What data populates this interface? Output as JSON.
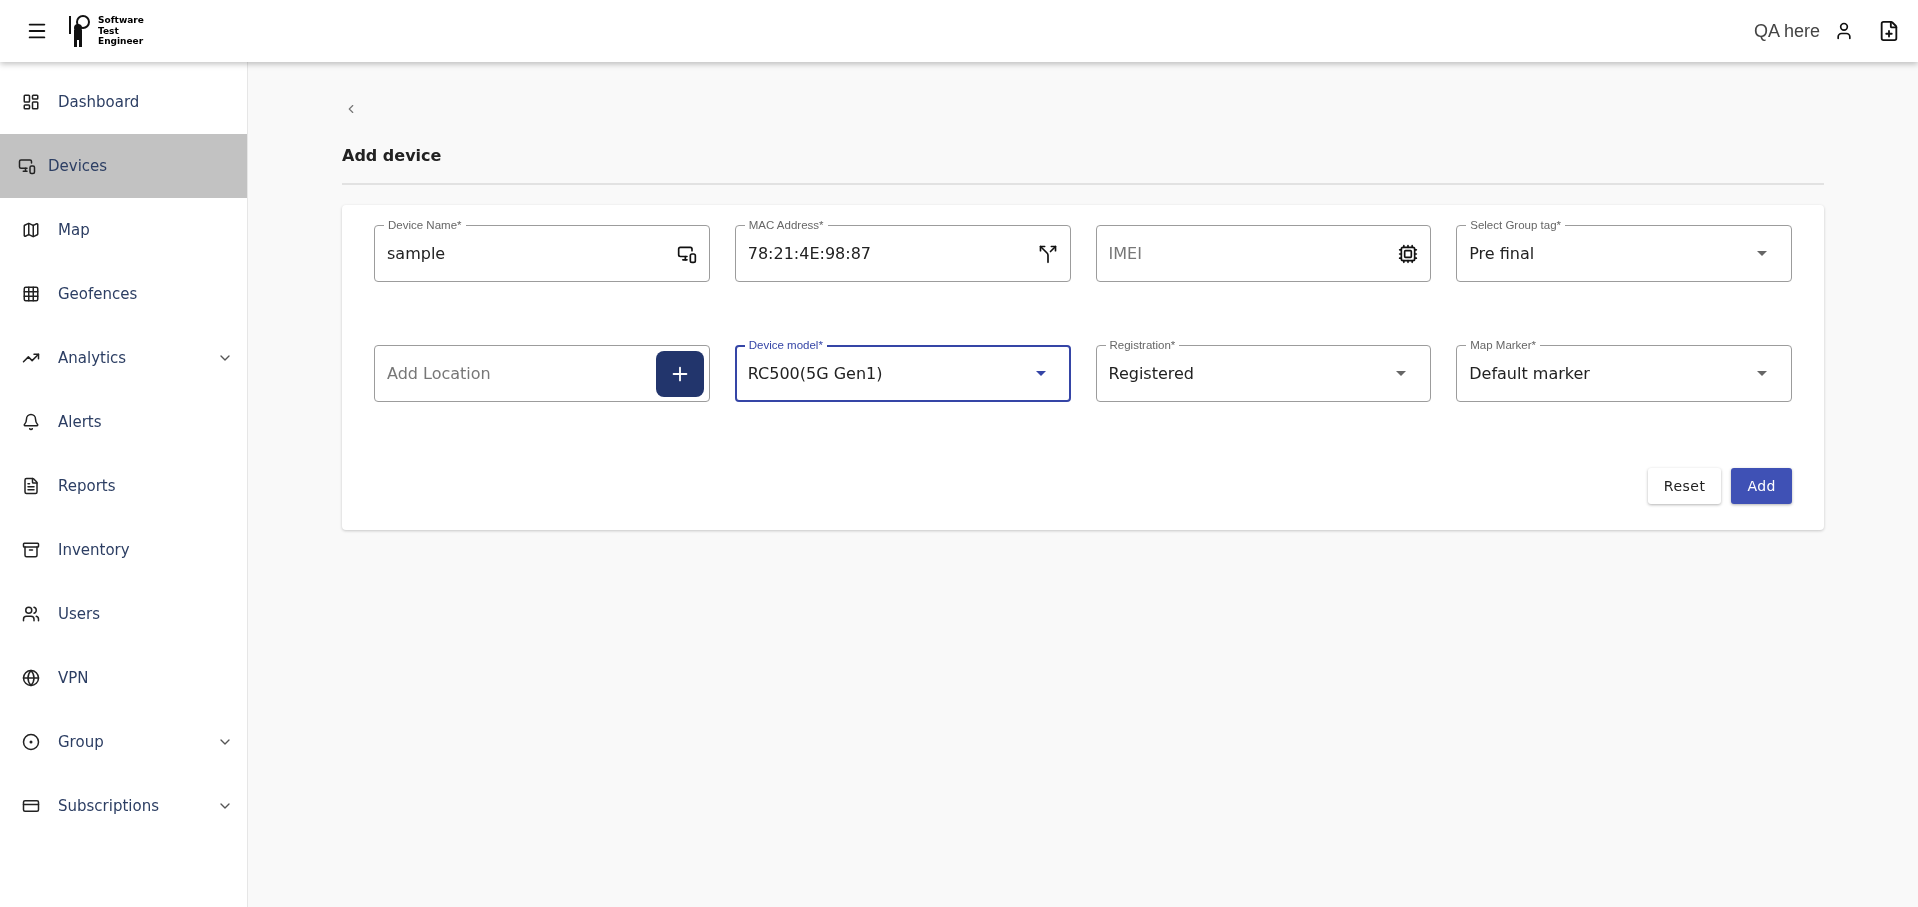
{
  "header": {
    "logo_text": [
      "Software",
      "Test",
      "Engineer"
    ],
    "user_name": "QA here"
  },
  "sidebar": {
    "items": [
      {
        "label": "Dashboard",
        "selected": false,
        "kind": "link"
      },
      {
        "label": "Devices",
        "selected": true,
        "kind": "link"
      },
      {
        "label": "Map",
        "selected": false,
        "kind": "link"
      },
      {
        "label": "Geofences",
        "selected": false,
        "kind": "link"
      },
      {
        "label": "Analytics",
        "selected": false,
        "kind": "group"
      },
      {
        "label": "Alerts",
        "selected": false,
        "kind": "link"
      },
      {
        "label": "Reports",
        "selected": false,
        "kind": "link"
      },
      {
        "label": "Inventory",
        "selected": false,
        "kind": "link"
      },
      {
        "label": "Users",
        "selected": false,
        "kind": "link"
      },
      {
        "label": "VPN",
        "selected": false,
        "kind": "link"
      },
      {
        "label": "Group",
        "selected": false,
        "kind": "group"
      },
      {
        "label": "Subscriptions",
        "selected": false,
        "kind": "group"
      }
    ]
  },
  "page": {
    "title": "Add device"
  },
  "form": {
    "fields": [
      {
        "kind": "text",
        "label": "Device Name*",
        "value": "sample",
        "focused": false
      },
      {
        "kind": "text",
        "label": "MAC Address*",
        "value": "78:21:4E:98:87",
        "focused": false
      },
      {
        "kind": "text",
        "placeholder": "IMEI",
        "focused": false
      },
      {
        "kind": "select",
        "label": "Select Group tag*",
        "value": "Pre final",
        "focused": false
      },
      {
        "kind": "location",
        "placeholder": "Add Location",
        "focused": false
      },
      {
        "kind": "select",
        "label": "Device model*",
        "value": "RC500(5G Gen1)",
        "focused": true
      },
      {
        "kind": "select",
        "label": "Registration*",
        "value": "Registered",
        "focused": false
      },
      {
        "kind": "select",
        "label": "Map Marker*",
        "value": "Default marker",
        "focused": false
      }
    ],
    "buttons": [
      {
        "label": "Reset",
        "kind": "secondary"
      },
      {
        "label": "Add",
        "kind": "primary"
      }
    ]
  }
}
